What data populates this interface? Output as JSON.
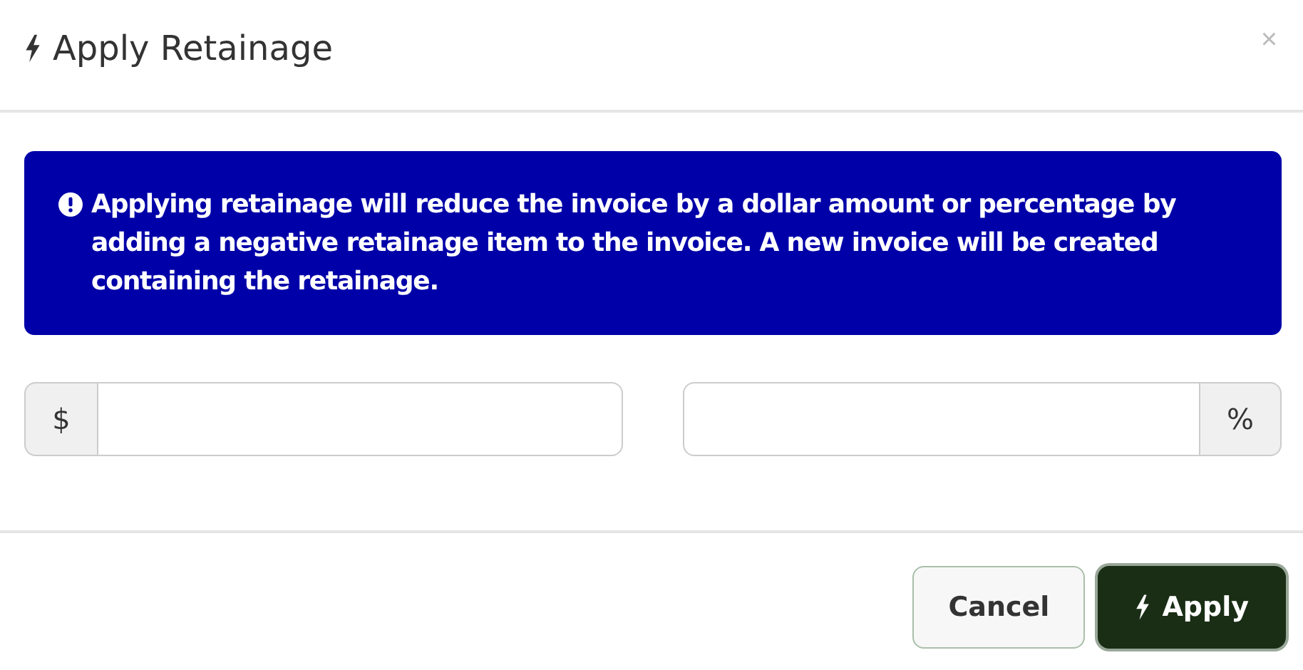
{
  "modal": {
    "title": "Apply Retainage",
    "close": "×"
  },
  "alert": {
    "text": "Applying retainage will reduce the invoice by a dollar amount or percentage by adding a negative retainage item to the invoice. A new invoice will be created containing the retainage."
  },
  "fields": [
    {
      "kind": "prefix",
      "addon": "$"
    },
    {
      "kind": "suffix",
      "addon": "%"
    }
  ],
  "buttons": [
    {
      "kind": "secondary",
      "label": "Cancel"
    },
    {
      "kind": "primary",
      "label": "Apply"
    }
  ]
}
